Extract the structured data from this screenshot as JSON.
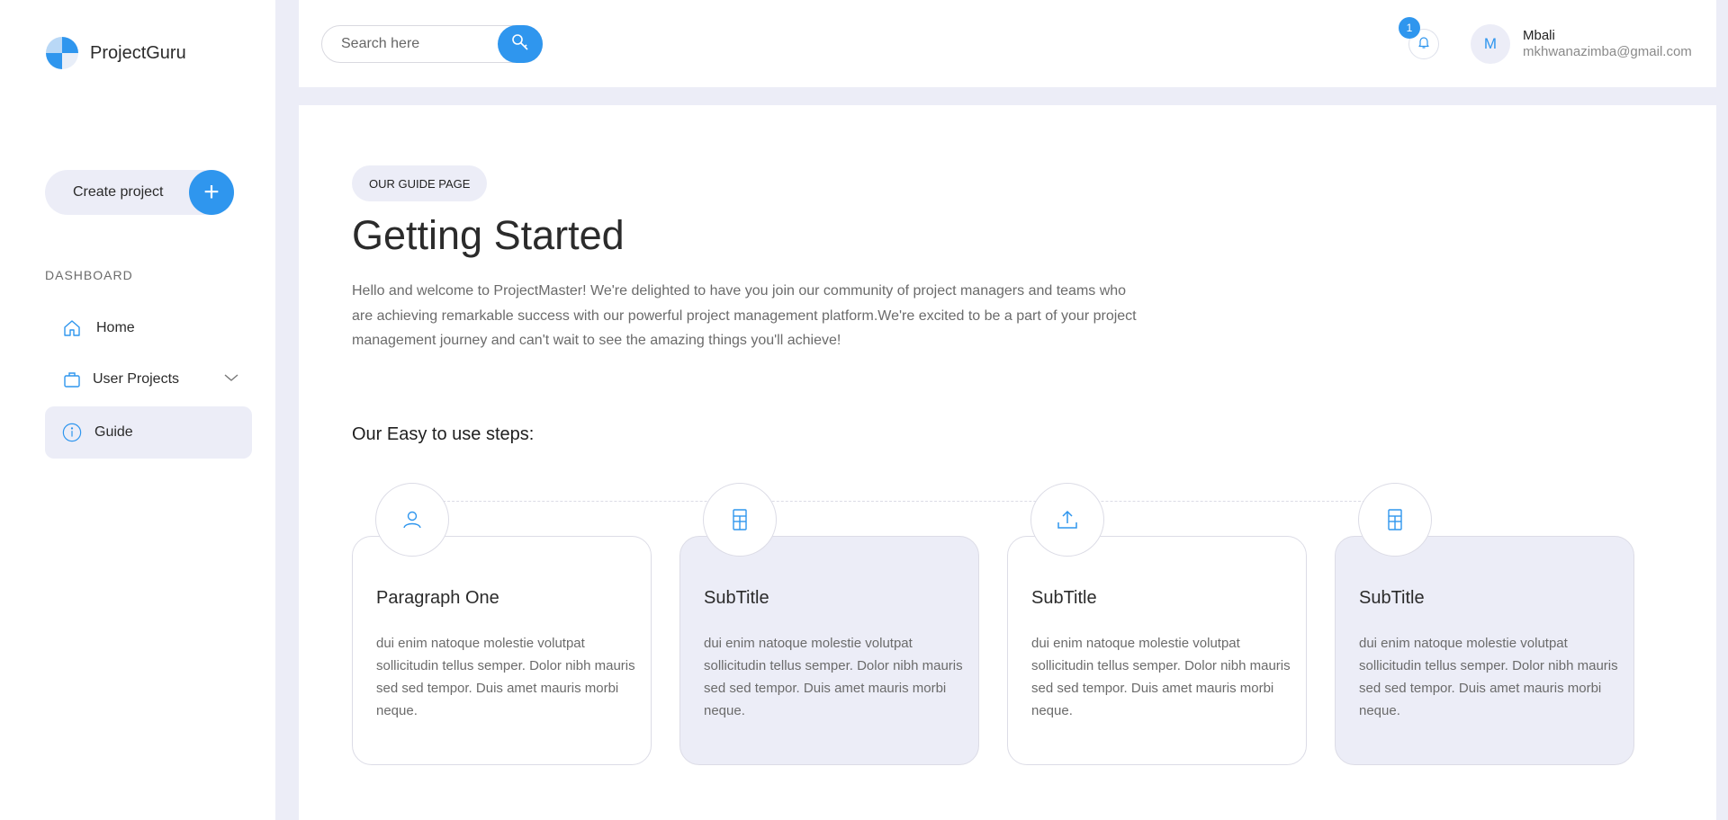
{
  "app": {
    "name": "ProjectGuru"
  },
  "sidebar": {
    "create_label": "Create project",
    "section_label": "DASHBOARD",
    "items": [
      {
        "label": "Home",
        "icon": "home-icon"
      },
      {
        "label": "User Projects",
        "icon": "briefcase-icon"
      },
      {
        "label": "Guide",
        "icon": "info-icon",
        "active": true
      }
    ]
  },
  "header": {
    "search_placeholder": "Search here",
    "notification_count": "1",
    "user": {
      "initial": "M",
      "name": "Mbali",
      "email": "mkhwanazimba@gmail.com"
    }
  },
  "main": {
    "tag": "OUR GUIDE PAGE",
    "title": "Getting Started",
    "intro": "Hello and welcome to ProjectMaster! We're delighted to have you join our community of project managers and teams who are achieving remarkable success with our powerful project management platform.We're excited to be a part of your project management journey and can't wait to see the amazing things you'll achieve!",
    "steps_heading": "Our Easy to use steps:",
    "steps": [
      {
        "title": "Paragraph One",
        "text": "dui enim natoque molestie volutpat sollicitudin tellus semper. Dolor nibh mauris sed sed tempor. Duis amet mauris morbi neque.",
        "icon": "user-icon"
      },
      {
        "title": "SubTitle",
        "text": "dui enim natoque molestie volutpat sollicitudin tellus semper. Dolor nibh mauris sed sed tempor. Duis amet mauris morbi neque.",
        "icon": "building-icon"
      },
      {
        "title": "SubTitle",
        "text": "dui enim natoque molestie volutpat sollicitudin tellus semper. Dolor nibh mauris sed sed tempor. Duis amet mauris morbi neque.",
        "icon": "upload-icon"
      },
      {
        "title": "SubTitle",
        "text": "dui enim natoque molestie volutpat sollicitudin tellus semper. Dolor nibh mauris sed sed tempor. Duis amet mauris morbi neque.",
        "icon": "building-icon"
      }
    ]
  },
  "colors": {
    "accent": "#2f96ee",
    "background": "#ecedf7",
    "surface": "#ffffff"
  }
}
